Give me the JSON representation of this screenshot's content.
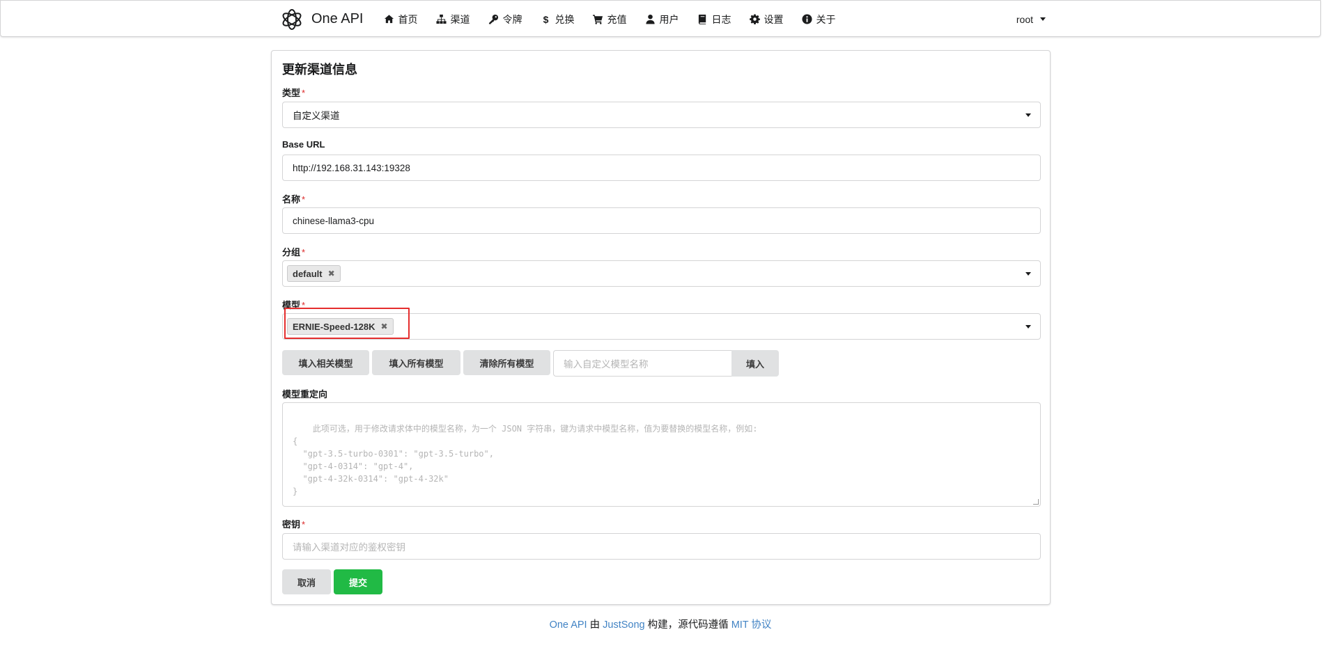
{
  "header": {
    "brand": "One API",
    "nav": [
      {
        "label": "首页",
        "icon": "home-icon"
      },
      {
        "label": "渠道",
        "icon": "sitemap-icon"
      },
      {
        "label": "令牌",
        "icon": "key-icon"
      },
      {
        "label": "兑换",
        "icon": "dollar-icon"
      },
      {
        "label": "充值",
        "icon": "cart-icon"
      },
      {
        "label": "用户",
        "icon": "user-icon"
      },
      {
        "label": "日志",
        "icon": "book-icon"
      },
      {
        "label": "设置",
        "icon": "gear-icon"
      },
      {
        "label": "关于",
        "icon": "info-icon"
      }
    ],
    "user": "root"
  },
  "form": {
    "title": "更新渠道信息",
    "type_label": "类型",
    "type_value": "自定义渠道",
    "base_url_label": "Base URL",
    "base_url_value": "http://192.168.31.143:19328",
    "name_label": "名称",
    "name_value": "chinese-llama3-cpu",
    "group_label": "分组",
    "group_chip": "default",
    "model_label": "模型",
    "model_chip": "ERNIE-Speed-128K",
    "required_mark": "*",
    "buttons": {
      "fill_related": "填入相关模型",
      "fill_all": "填入所有模型",
      "clear_all": "清除所有模型",
      "custom_model_placeholder": "输入自定义模型名称",
      "fill": "填入"
    },
    "redirect_label": "模型重定向",
    "redirect_placeholder": "此项可选，用于修改请求体中的模型名称，为一个 JSON 字符串，键为请求中模型名称，值为要替换的模型名称，例如:\n{\n  \"gpt-3.5-turbo-0301\": \"gpt-3.5-turbo\",\n  \"gpt-4-0314\": \"gpt-4\",\n  \"gpt-4-32k-0314\": \"gpt-4-32k\"\n}",
    "key_label": "密钥",
    "key_placeholder": "请输入渠道对应的鉴权密钥",
    "cancel": "取消",
    "submit": "提交"
  },
  "footer": {
    "link1": "One API",
    "text1": " 由 ",
    "link2": "JustSong",
    "text2": " 构建，源代码遵循 ",
    "link3": "MIT 协议"
  },
  "colors": {
    "submit_green": "#21ba45",
    "link_blue": "#4183c4",
    "highlight_red": "#e52d2d",
    "required_red": "#db2828"
  }
}
